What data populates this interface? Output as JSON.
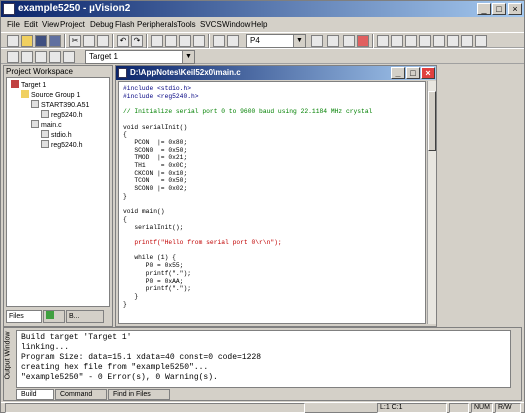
{
  "app": {
    "title": "example5250 - µVision2"
  },
  "menu": [
    "File",
    "Edit",
    "View",
    "Project",
    "Debug",
    "Flash",
    "Peripherals",
    "Tools",
    "SVCS",
    "Window",
    "Help"
  ],
  "toolbar": {
    "find_combo_value": "P4",
    "target_combo_value": "Target 1"
  },
  "workspace": {
    "title": "Project Workspace",
    "tree": [
      {
        "label": "Target 1",
        "level": 0,
        "icon": "target-icon"
      },
      {
        "label": "Source Group 1",
        "level": 1,
        "icon": "folder-icon"
      },
      {
        "label": "START390.A51",
        "level": 2,
        "icon": "file-icon"
      },
      {
        "label": "reg5240.h",
        "level": 3,
        "icon": "file-icon"
      },
      {
        "label": "main.c",
        "level": 2,
        "icon": "file-icon"
      },
      {
        "label": "stdio.h",
        "level": 3,
        "icon": "file-icon"
      },
      {
        "label": "reg5240.h",
        "level": 3,
        "icon": "file-icon"
      }
    ],
    "tabs": [
      "Files",
      "",
      "B..."
    ]
  },
  "editor": {
    "title": "D:\\AppNotes\\Keil52x0\\main.c",
    "lines": [
      {
        "t": "#include <stdio.h>",
        "k": "pp"
      },
      {
        "t": "#include <reg5240.h>",
        "k": "pp"
      },
      {
        "t": "",
        "k": ""
      },
      {
        "t": "// Initialize serial port 0 to 9600 baud using 22.1184 MHz crystal",
        "k": "cm"
      },
      {
        "t": "",
        "k": ""
      },
      {
        "t": "void serialInit()",
        "k": ""
      },
      {
        "t": "{",
        "k": ""
      },
      {
        "t": "   PCON  |= 0x80;",
        "k": ""
      },
      {
        "t": "   SCON0  = 0x50;",
        "k": ""
      },
      {
        "t": "   TMOD  |= 0x21;",
        "k": ""
      },
      {
        "t": "   TH1    = 0x0C;",
        "k": ""
      },
      {
        "t": "   CKCON |= 0x10;",
        "k": ""
      },
      {
        "t": "   TCON   = 0x50;",
        "k": ""
      },
      {
        "t": "   SCON0 |= 0x02;",
        "k": ""
      },
      {
        "t": "}",
        "k": ""
      },
      {
        "t": "",
        "k": ""
      },
      {
        "t": "void main()",
        "k": ""
      },
      {
        "t": "{",
        "k": ""
      },
      {
        "t": "   serialInit();",
        "k": ""
      },
      {
        "t": "",
        "k": ""
      },
      {
        "t": "   printf(\"Hello from serial port 0\\r\\n\");",
        "k": "str"
      },
      {
        "t": "",
        "k": ""
      },
      {
        "t": "   while (1) {",
        "k": ""
      },
      {
        "t": "      P0 = 0x55;",
        "k": ""
      },
      {
        "t": "      printf(\".\");",
        "k": ""
      },
      {
        "t": "      P0 = 0xAA;",
        "k": ""
      },
      {
        "t": "      printf(\".\");",
        "k": ""
      },
      {
        "t": "   }",
        "k": ""
      },
      {
        "t": "}",
        "k": ""
      }
    ]
  },
  "output": {
    "label": "Output Window",
    "lines": [
      "Build target 'Target 1'",
      "linking...",
      "Program Size: data=15.1 xdata=40 const=0 code=1228",
      "creating hex file from \"example5250\"...",
      "\"example5250\" - 0 Error(s), 0 Warning(s)."
    ],
    "tabs": [
      "Build",
      "Command",
      "Find in Files"
    ]
  },
  "status": {
    "position": "L:1 C:1",
    "num": "NUM",
    "rw": "R/W"
  }
}
